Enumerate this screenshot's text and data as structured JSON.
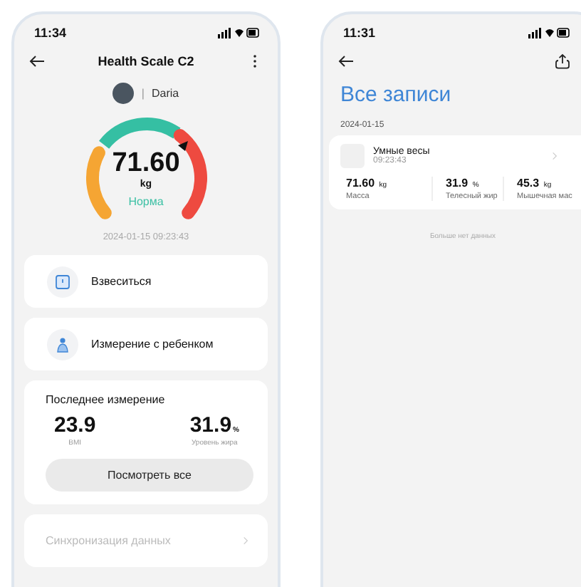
{
  "left_screen": {
    "status_bar": {
      "time": "11:34"
    },
    "header": {
      "title": "Health Scale C2"
    },
    "user": {
      "separator": "|",
      "name": "Daria"
    },
    "gauge": {
      "value": "71.60",
      "unit": "kg",
      "status": "Норма",
      "timestamp": "2024-01-15 09:23:43"
    },
    "actions": [
      {
        "kind": "weigh",
        "label": "Взвеситься"
      },
      {
        "kind": "child",
        "label": "Измерение с ребенком"
      }
    ],
    "last_measurement": {
      "title": "Последнее измерение",
      "metrics": [
        {
          "value": "23.9",
          "label": "BMI"
        },
        {
          "value": "31.9",
          "unit": "%",
          "label": "Уровень жира"
        }
      ],
      "button": "Посмотреть все"
    },
    "sync": {
      "label": "Синхронизация данных",
      "disabled": true
    }
  },
  "right_screen": {
    "status_bar": {
      "time": "11:31"
    },
    "title": "Все записи",
    "date": "2024-01-15",
    "record": {
      "device": "Умные весы",
      "time": "09:23:43",
      "metrics": [
        {
          "value": "71.60",
          "unit": "kg",
          "label": "Масса"
        },
        {
          "value": "31.9",
          "unit": "%",
          "label": "Телесный жир"
        },
        {
          "value": "45.3",
          "unit": "kg",
          "label": "Мышечная мас"
        }
      ]
    },
    "footer": "Больше нет данных"
  }
}
